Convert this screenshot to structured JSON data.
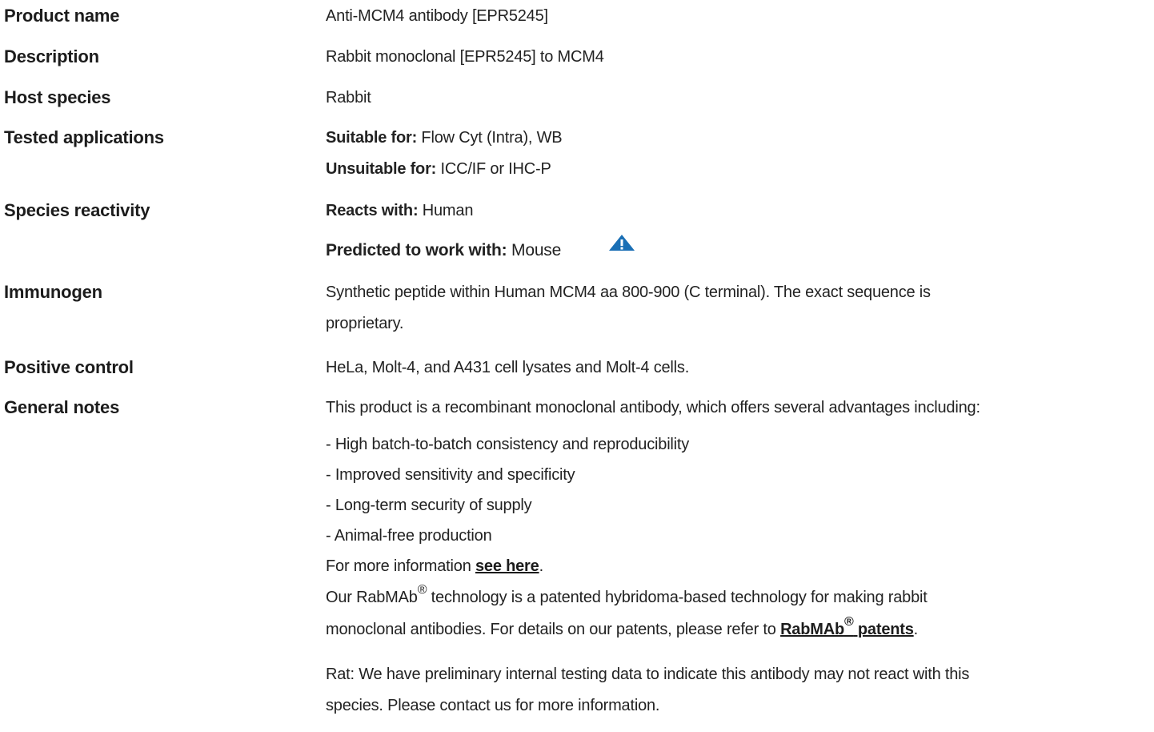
{
  "rows": [
    {
      "label": "Product name",
      "value": "Anti-MCM4 antibody [EPR5245]"
    },
    {
      "label": "Description",
      "value": "Rabbit monoclonal [EPR5245] to MCM4"
    },
    {
      "label": "Host species",
      "value": "Rabbit"
    },
    {
      "label": "Tested applications",
      "suitable_label": "Suitable for:",
      "suitable_value": " Flow Cyt (Intra), WB",
      "unsuitable_label": "Unsuitable for:",
      "unsuitable_value": " ICC/IF or IHC-P"
    },
    {
      "label": "Species reactivity",
      "reacts_label": "Reacts with:",
      "reacts_value": " Human",
      "predicted_label": "Predicted to work with:",
      "predicted_value": " Mouse"
    },
    {
      "label": "Immunogen",
      "line1": "Synthetic peptide within Human MCM4 aa 800-900 (C terminal). The exact sequence is",
      "line2": "proprietary."
    },
    {
      "label": "Positive control",
      "value": "HeLa, Molt-4, and A431 cell lysates and Molt-4 cells."
    },
    {
      "label": "General notes",
      "intro": "This product is a recombinant monoclonal antibody, which offers several advantages including:",
      "bullets": [
        "- High batch-to-batch consistency and reproducibility",
        "- Improved sensitivity and specificity",
        "- Long-term security of supply",
        "- Animal-free production"
      ],
      "more_info_prefix": "For more information ",
      "more_info_link": "see here",
      "more_info_suffix": ".",
      "rabmab_prefix": "Our RabMAb",
      "registered": "®",
      "rabmab_rest": " technology is a patented hybridoma-based technology for making rabbit",
      "rabmab_line2_prefix": "monoclonal antibodies. For details on our patents, please refer to ",
      "patents_link_a": "RabMAb",
      "patents_link_b": " patents",
      "rabmab_line2_suffix": ".",
      "rat_line1": "Rat: We have preliminary internal testing data to indicate this antibody may not react with this",
      "rat_line2": "species. Please contact us for more information."
    }
  ],
  "icons": {
    "warning": "warning-triangle-icon",
    "warning_color": "#1a6fb5"
  }
}
